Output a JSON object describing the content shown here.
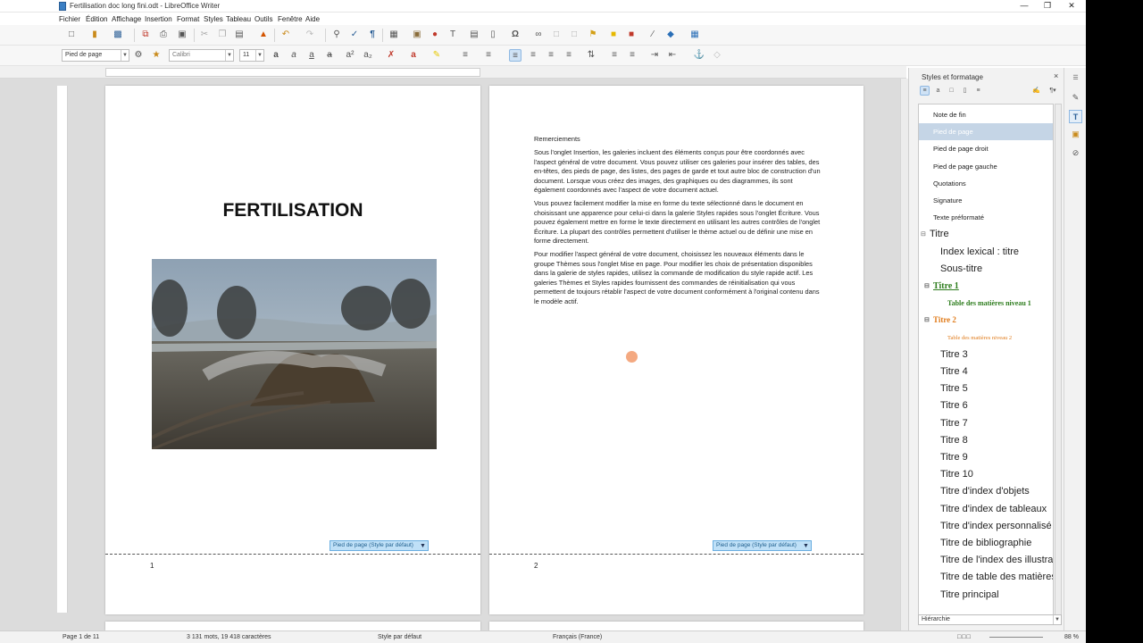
{
  "window": {
    "title": "Fertilisation doc long fini.odt - LibreOffice Writer"
  },
  "menubar": [
    "Fichier",
    "Édition",
    "Affichage",
    "Insertion",
    "Format",
    "Styles",
    "Tableau",
    "Outils",
    "Fenêtre",
    "Aide"
  ],
  "formatbar": {
    "paragraph_style": "Pied de page",
    "font_name": "Calibri",
    "font_size": "11"
  },
  "page1": {
    "title": "FERTILISATION",
    "footer_tag": "Pied de page (Style par défaut)",
    "page_number": "1"
  },
  "page2": {
    "heading": "Remerciements",
    "paragraphs": [
      "Sous l'onglet Insertion, les galeries incluent des éléments conçus pour être coordonnés avec l'aspect général de votre document. Vous pouvez utiliser ces galeries pour insérer des tables, des en-têtes, des pieds de page, des listes, des pages de garde et tout autre bloc de construction d'un document. Lorsque vous créez des images, des graphiques ou des diagrammes, ils sont également coordonnés avec l'aspect de votre document actuel.",
      "Vous pouvez facilement modifier la mise en forme du texte sélectionné dans le document en choisissant une apparence pour celui-ci dans la galerie Styles rapides sous l'onglet Écriture. Vous pouvez également mettre en forme le texte directement en utilisant les autres contrôles de l'onglet Écriture. La plupart des contrôles permettent d'utiliser le thème actuel ou de définir une mise en forme directement.",
      "Pour modifier l'aspect général de votre document, choisissez les nouveaux éléments dans le groupe Thèmes sous l'onglet Mise en page. Pour modifier les choix de présentation disponibles dans la galerie de styles rapides, utilisez la commande de modification du style rapide actif. Les galeries Thèmes et Styles rapides fournissent des commandes de réinitialisation qui vous permettent de toujours rétablir l'aspect de votre document conformément à l'original contenu dans le modèle actif."
    ],
    "footer_tag": "Pied de page (Style par défaut)",
    "page_number": "2"
  },
  "styles_panel": {
    "title": "Styles et formatage",
    "close": "×",
    "items": [
      {
        "label": "Note de fin",
        "kind": "small"
      },
      {
        "label": "Pied de page",
        "kind": "small",
        "selected": true
      },
      {
        "label": "Pied de page droit",
        "kind": "small"
      },
      {
        "label": "Pied de page gauche",
        "kind": "small"
      },
      {
        "label": "Quotations",
        "kind": "small"
      },
      {
        "label": "Signature",
        "kind": "small"
      },
      {
        "label": "Texte préformaté",
        "kind": "small"
      },
      {
        "label": "Titre",
        "kind": "big",
        "collapse": "⊟"
      },
      {
        "label": "Index lexical : titre",
        "kind": "big"
      },
      {
        "label": "Sous-titre",
        "kind": "big"
      },
      {
        "label": "Titre 1",
        "kind": "h1",
        "collapse": "⊟"
      },
      {
        "label": "Table des matières niveau 1",
        "kind": "toc1"
      },
      {
        "label": "Titre 2",
        "kind": "h2",
        "collapse": "⊟"
      },
      {
        "label": "Table des matières niveau 2",
        "kind": "toc2"
      },
      {
        "label": "Titre 3",
        "kind": "big"
      },
      {
        "label": "Titre 4",
        "kind": "big"
      },
      {
        "label": "Titre 5",
        "kind": "big"
      },
      {
        "label": "Titre 6",
        "kind": "big"
      },
      {
        "label": "Titre 7",
        "kind": "big"
      },
      {
        "label": "Titre 8",
        "kind": "big"
      },
      {
        "label": "Titre 9",
        "kind": "big"
      },
      {
        "label": "Titre 10",
        "kind": "big"
      },
      {
        "label": "Titre d'index d'objets",
        "kind": "big"
      },
      {
        "label": "Titre d'index de tableaux",
        "kind": "big"
      },
      {
        "label": "Titre d'index personnalisé",
        "kind": "big"
      },
      {
        "label": "Titre de bibliographie",
        "kind": "big"
      },
      {
        "label": "Titre de l'index des illustrations",
        "kind": "big"
      },
      {
        "label": "Titre de table des matières",
        "kind": "big"
      },
      {
        "label": "Titre principal",
        "kind": "big"
      }
    ],
    "filter": "Hiérarchie"
  },
  "statusbar": {
    "page": "Page 1 de 11",
    "words": "3 131 mots, 19 418 caractères",
    "page_style": "Style par défaut",
    "language": "Français (France)",
    "zoom": "88 %"
  },
  "colors": {
    "heading1": "#2e7d1e",
    "heading2": "#e07b1a",
    "selected": "#c5d5e6"
  }
}
